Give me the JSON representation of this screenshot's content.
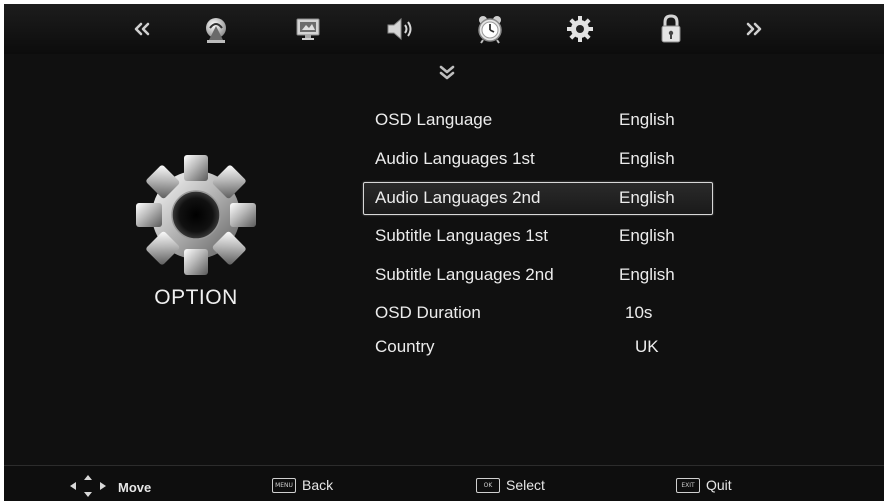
{
  "top_bar": {
    "icons": [
      "double-left-arrow-icon",
      "channel-antenna-icon",
      "picture-icon",
      "sound-icon",
      "alarm-clock-icon",
      "gear-icon",
      "lock-icon",
      "double-right-arrow-icon"
    ],
    "selected_icon": "gear-icon"
  },
  "section": {
    "title": "OPTION",
    "icon": "gear-icon"
  },
  "menu": {
    "items": [
      {
        "label": "OSD Language",
        "value": "English"
      },
      {
        "label": "Audio Languages 1st",
        "value": "English"
      },
      {
        "label": "Audio Languages 2nd",
        "value": "English"
      },
      {
        "label": "Subtitle Languages 1st",
        "value": "English"
      },
      {
        "label": "Subtitle Languages 2nd",
        "value": "English"
      },
      {
        "label": "OSD Duration",
        "value": "10s"
      },
      {
        "label": "Country",
        "value": "UK"
      }
    ],
    "selected_index": 2
  },
  "hints": {
    "move": "Move",
    "back_key": "MENU",
    "back": "Back",
    "select_key": "OK",
    "select": "Select",
    "quit_key": "EXIT",
    "quit": "Quit"
  },
  "colors": {
    "background": "#101010",
    "text": "#ececec",
    "highlight_border": "#d8d8d8"
  }
}
